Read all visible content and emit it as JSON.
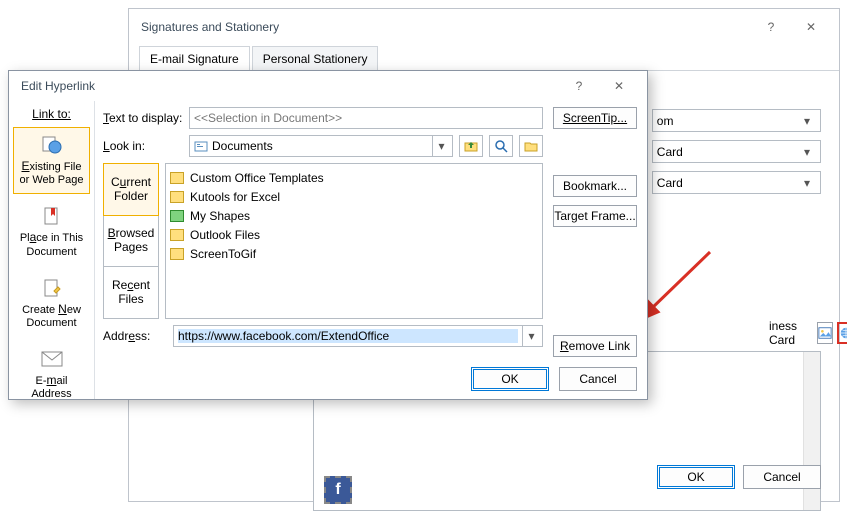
{
  "sig_dialog": {
    "title": "Signatures and Stationery",
    "tabs": [
      "E-mail Signature",
      "Personal Stationery"
    ],
    "rows": {
      "r1_suffix": "om",
      "r2_suffix": "Card",
      "r3_suffix": "Card"
    },
    "biz_card_label": "iness Card",
    "ok": "OK",
    "cancel": "Cancel"
  },
  "edit_dialog": {
    "title": "Edit Hyperlink",
    "link_to_label": "Link to:",
    "link_to": [
      {
        "key": "existing",
        "label": "Existing File or Web Page"
      },
      {
        "key": "place",
        "label": "Place in This Document"
      },
      {
        "key": "create",
        "label": "Create New Document"
      },
      {
        "key": "email",
        "label": "E-mail Address"
      }
    ],
    "text_to_display_label": "Text to display:",
    "text_to_display_value": "<<Selection in Document>>",
    "screentip": "ScreenTip...",
    "look_in_label": "Look in:",
    "look_in_value": "Documents",
    "folder_tabs": [
      "Current Folder",
      "Browsed Pages",
      "Recent Files"
    ],
    "files": [
      "Custom Office Templates",
      "Kutools for Excel",
      "My Shapes",
      "Outlook Files",
      "ScreenToGif"
    ],
    "bookmark": "Bookmark...",
    "target_frame": "Target Frame...",
    "remove_link": "Remove Link",
    "address_label": "Address:",
    "address_value": "https://www.facebook.com/ExtendOffice",
    "ok": "OK",
    "cancel": "Cancel"
  }
}
